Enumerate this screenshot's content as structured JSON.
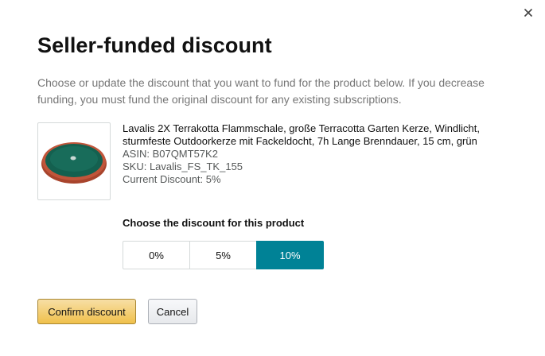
{
  "dialog": {
    "title": "Seller-funded discount",
    "description": "Choose or update the discount that you want to fund for the product below. If you decrease funding, you must fund the original discount for any existing subscriptions.",
    "close_icon": "close-icon"
  },
  "product": {
    "image_icon": "product-thumbnail",
    "name": "Lavalis 2X Terrakotta Flammschale, große Terracotta Garten Kerze, Windlicht, sturmfeste Outdoorkerze mit Fackeldocht, 7h Lange Brenndauer, 15 cm, grün",
    "asin": "ASIN: B07QMT57K2",
    "sku": "SKU: Lavalis_FS_TK_155",
    "current_discount": "Current Discount: 5%"
  },
  "discount": {
    "label": "Choose the discount for this product",
    "options": [
      "0%",
      "5%",
      "10%"
    ],
    "selected": "10%",
    "selected_color": "#008296"
  },
  "actions": {
    "confirm_label": "Confirm discount",
    "cancel_label": "Cancel",
    "confirm_color": "#f0c14b"
  }
}
